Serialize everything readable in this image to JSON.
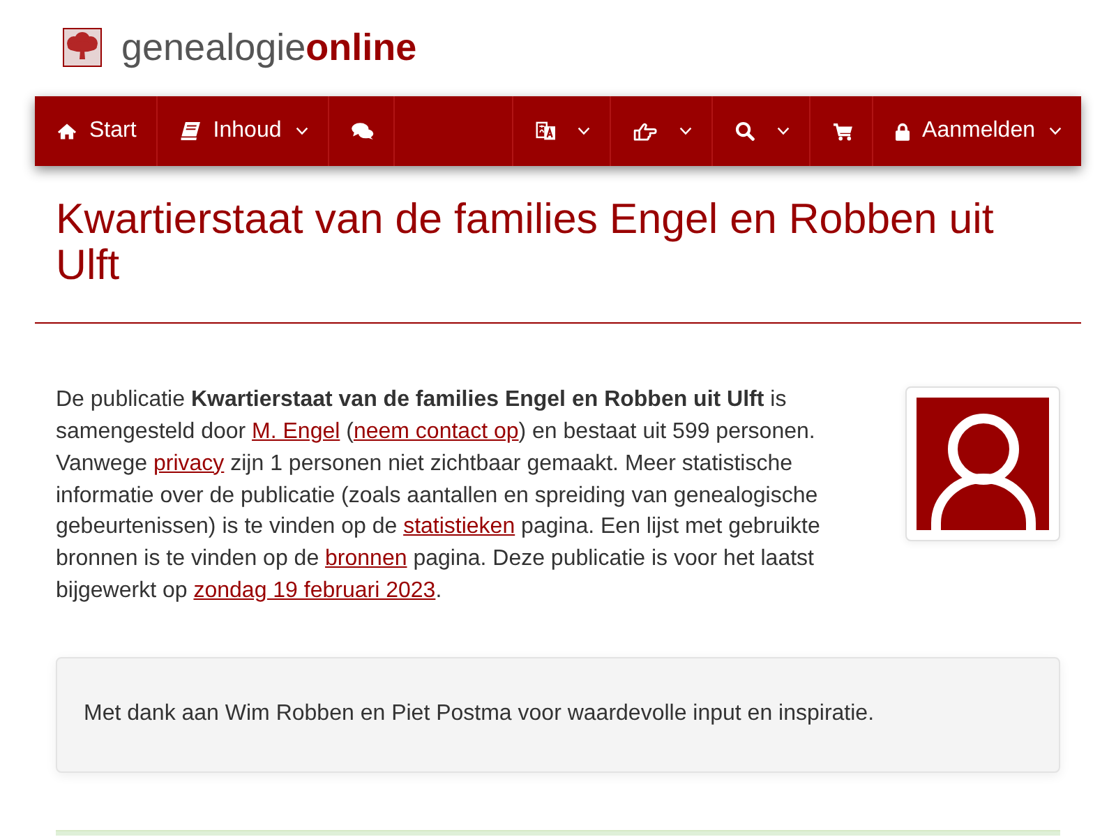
{
  "header": {
    "logo_text": "genealogie**online**"
  },
  "navbar": {
    "left": [
      {
        "label": "Start",
        "dropdown": false
      },
      {
        "label": "Inhoud",
        "dropdown": true
      },
      {
        "dropdown": false
      }
    ],
    "right": [
      {
        "dropdown": true
      },
      {
        "dropdown": true
      },
      {
        "dropdown": true
      },
      {
        "dropdown": false
      },
      {
        "label": "Aanmelden",
        "dropdown": true
      }
    ]
  },
  "title": "Kwartierstaat van de families Engel en Robben uit Ulft",
  "intro": {
    "segments": [
      {
        "kind": "text",
        "text": "De publicatie **Kwartierstaat van de families Engel en Robben uit Ulft** is samengesteld door "
      },
      {
        "kind": "link",
        "text": "M. Engel"
      },
      {
        "kind": "text",
        "text": " ("
      },
      {
        "kind": "link",
        "text": "neem contact op"
      },
      {
        "kind": "text",
        "text": ") en bestaat uit 599 personen. Vanwege "
      },
      {
        "kind": "link",
        "text": "privacy"
      },
      {
        "kind": "text",
        "text": " zijn 1 personen niet zichtbaar gemaakt. Meer statistische informatie over de publicatie (zoals aantallen en spreiding van genealogische gebeurtenissen) is te vinden op de "
      },
      {
        "kind": "link",
        "text": "statistieken"
      },
      {
        "kind": "text",
        "text": " pagina. Een lijst met gebruikte bronnen is te vinden op de "
      },
      {
        "kind": "link",
        "text": "bronnen"
      },
      {
        "kind": "text",
        "text": " pagina. Deze publicatie is voor het laatst bijgewerkt op "
      },
      {
        "kind": "link",
        "text": "zondag 19 februari 2023"
      },
      {
        "kind": "text",
        "text": "."
      }
    ]
  },
  "acknowledgement": "Met dank aan Wim Robben en Piet Postma voor waardevolle input en inspiratie."
}
